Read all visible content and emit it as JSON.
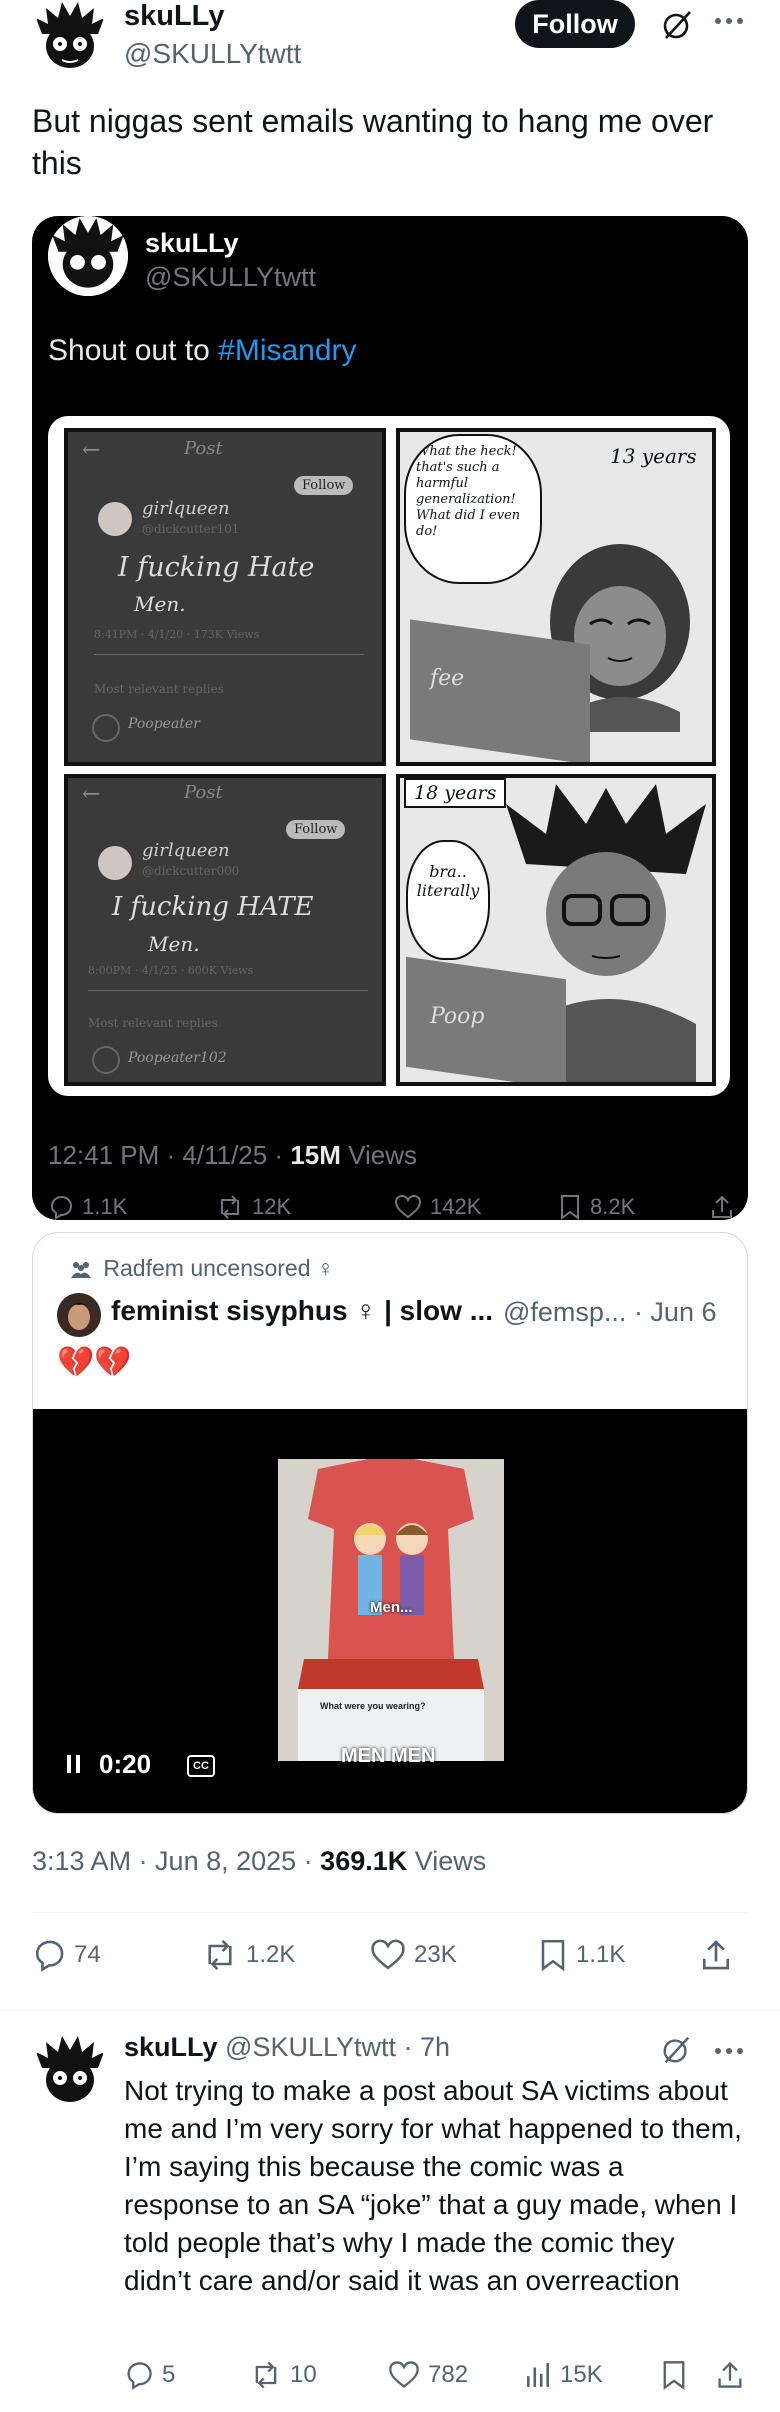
{
  "post": {
    "author_name": "skuLLy",
    "author_handle": "@SKULLYtwtt",
    "follow_label": "Follow",
    "text": "But niggas sent emails wanting to hang me over this"
  },
  "quoted": {
    "author_name": "skuLLy",
    "author_handle": "@SKULLYtwtt",
    "text_prefix": "Shout out to ",
    "hashtag": "#Misandry",
    "time": "12:41 PM · 4/11/25 · ",
    "views_count": "15M",
    "views_label": " Views",
    "actions": {
      "replies": "1.1K",
      "reposts": "12K",
      "likes": "142K",
      "bookmarks": "8.2K"
    },
    "comic": {
      "panel1": {
        "header": "Post",
        "follow": "Follow",
        "user": "girlqueen",
        "subhandle": "@dickcutter101",
        "line1": "I fucking Hate",
        "line2": "Men.",
        "stats": "8:41PM · 4/1/20 · 173K Views",
        "more_replies": "Most relevant replies",
        "replier": "Poopeater"
      },
      "panel2": {
        "speech": "What the heck! that's such a harmful generalization! What did I even do!",
        "caption": "13 years",
        "screen": "fee"
      },
      "panel3": {
        "header": "Post",
        "follow": "Follow",
        "user": "girlqueen",
        "subhandle": "@dickcutter000",
        "line1": "I fucking HATE",
        "line2": "Men.",
        "stats": "8:00PM · 4/1/25 · 600K Views",
        "more_replies": "Most relevant replies",
        "replier": "Poopeater102"
      },
      "panel4": {
        "caption": "18 years",
        "speech": "bra.. literally",
        "screen": "Poop"
      }
    }
  },
  "quote_card": {
    "community": "Radfem uncensored ♀",
    "author_name": "feminist sisyphus ♀ | slow ...",
    "author_handle": "@femsp... · Jun 6",
    "emoji": "💔💔",
    "video": {
      "time": "0:20",
      "cc": "CC",
      "caption": "MEN MEN",
      "overlay_text": "Men...",
      "card_text": "What were you wearing?"
    }
  },
  "meta": {
    "time": "3:13 AM · Jun 8, 2025 · ",
    "views_count": "369.1K",
    "views_label": " Views"
  },
  "actions": {
    "replies": "74",
    "reposts": "1.2K",
    "likes": "23K",
    "bookmarks": "1.1K"
  },
  "reply": {
    "author_name": "skuLLy",
    "author_handle": "@SKULLYtwtt · 7h",
    "text": "Not trying to make a post about SA victims about me and I’m very sorry for what happened to them, I’m saying this because the comic was a response to an SA “joke” that a guy made, when I told people that’s why I made the comic they didn’t care and/or said it was an overreaction",
    "actions": {
      "replies": "5",
      "reposts": "10",
      "likes": "782",
      "views": "15K"
    }
  },
  "colors": {
    "accent": "#1d9bf0",
    "text": "#0f1419",
    "muted": "#536471"
  }
}
